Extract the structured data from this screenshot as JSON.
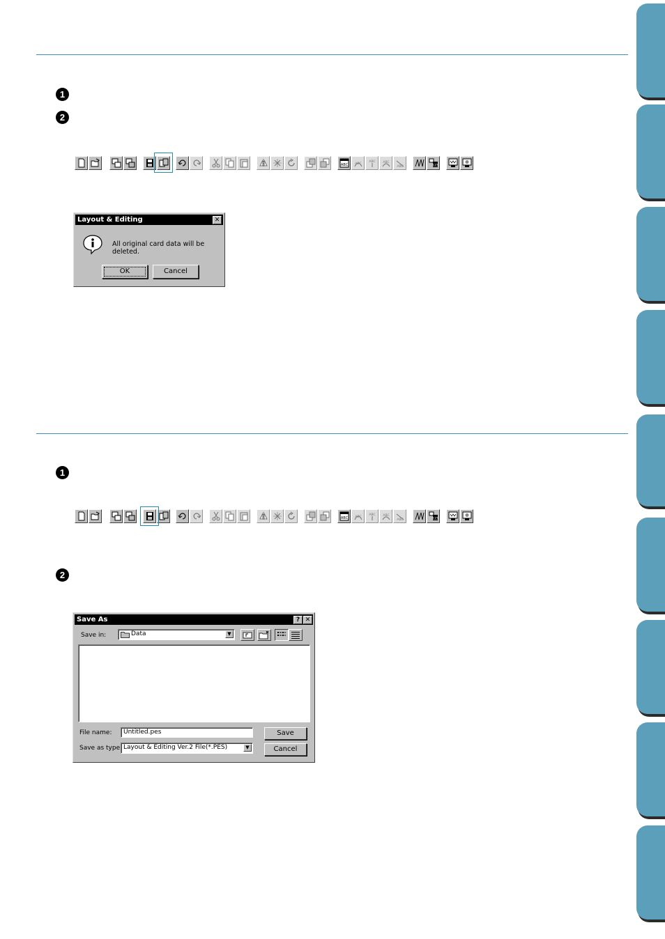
{
  "steps": {
    "s1": "1",
    "s2": "2",
    "s3": "1",
    "s4": "2"
  },
  "toolbar_icons": [
    "new-file-icon",
    "open-file-icon",
    "import-icon",
    "copy-import-icon",
    "save-icon",
    "write-card-icon",
    "undo-icon",
    "redo-icon",
    "cut-icon",
    "copy-icon",
    "paste-icon",
    "mirror-icon",
    "rotate-free-icon",
    "rotate-icon",
    "front-icon",
    "back-icon",
    "text-icon",
    "text-curve-icon",
    "text-vertical-icon",
    "text-arc-icon",
    "text-path-icon",
    "stitch-icon",
    "sequence-icon",
    "preview-icon",
    "realistic-preview-icon"
  ],
  "dialog1": {
    "title": "Layout & Editing",
    "close": "✕",
    "message": "All original card data will be deleted.",
    "ok": "OK",
    "cancel": "Cancel"
  },
  "dialog2": {
    "title": "Save As",
    "help": "?",
    "close": "✕",
    "save_in_label": "Save in:",
    "save_in_value": "Data",
    "file_name_label": "File name:",
    "file_name_value": "Untitled.pes",
    "save_as_type_label": "Save as type:",
    "save_as_type_value": "Layout & Editing Ver.2 File(*.PES)",
    "save": "Save",
    "cancel": "Cancel"
  },
  "colors": {
    "rule": "#3a8fb5",
    "tab": "#5b9fbb",
    "highlight": "#1f8fb0"
  }
}
